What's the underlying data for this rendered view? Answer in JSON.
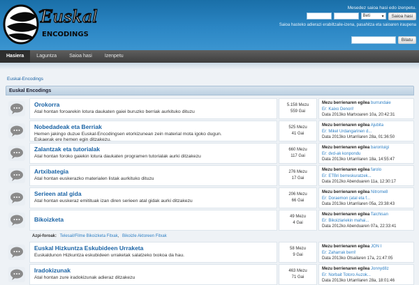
{
  "header": {
    "login_hint": "Mesedez saioa hasi edo izenpetu.",
    "duration_select": "Beti",
    "login_button": "Saioa hasi",
    "login_sub": "Saioa hasteko adierazi erabiltzaile-izena, pasahitza eta saioaren iraupena",
    "search_button": "Bilatu"
  },
  "nav": {
    "items": [
      "Hasiera",
      "Laguntza",
      "Saioa hasi",
      "Izenpetu"
    ]
  },
  "breadcrumb": "Euskal-Encodings",
  "category": "Euskal Encodings",
  "forums": [
    {
      "title": "Orokorra",
      "desc": "Atal hontan foroarekin lotura daukaten gaiei buruzko berriak aurkituko dituzu",
      "desc2": "",
      "messages": "5.158 Mezu",
      "topics": "559 Gai",
      "lp_label": "Mezu berrienaren egilea",
      "lp_user": "burrundaie",
      "lp_reply": "Er: Kaixo Denori!",
      "lp_date": "Data 2013ko Martxoaren 10a, 20:42:31"
    },
    {
      "title": "Nobedadeak eta Berriak",
      "desc": "Hemen jakingo duzue Euskal-Encodingsen etorkizunean zein material mota igoko dugun.",
      "desc2": "Eskaerak ere hemen egin ditzakezu.",
      "messages": "525 Mezu",
      "topics": "41 Gai",
      "lp_label": "Mezu berrienaren egilea",
      "lp_user": "Ajubita",
      "lp_reply": "Er: Mikel Urdangarinen d...",
      "lp_date": "Data 2013ko Urtarrilaren 28a, 01:36:50"
    },
    {
      "title": "Zalantzak eta tutorialak",
      "desc": "Atal hontan foroko gaiekin lotura daukaten programen tutorialak aurki ditzakezu",
      "desc2": "",
      "messages": "660 Mezu",
      "topics": "117 Gai",
      "lp_label": "Mezu berrienaren egilea",
      "lp_user": "baronluigi",
      "lp_reply": "Er: dvd-ak konpondu",
      "lp_date": "Data 2013ko Urtarrilaren 18a, 14:55:47"
    },
    {
      "title": "Artxibategia",
      "desc": "Atal hontan euskerazko materialen listak aurkituko dituzu",
      "desc2": "",
      "messages": "276 Mezu",
      "topics": "17 Gai",
      "lp_label": "Mezu berrienaren egilea",
      "lp_user": "farolo",
      "lp_reply": "Er: ETBri berreskuratzek...",
      "lp_date": "Data 2012ko Abenduaren 11a, 12:30:17"
    },
    {
      "title": "Serieen atal gida",
      "desc": "Atal hontan euskeraz emitituak izan diren serieen atal gidak aurki ditzakezu",
      "desc2": "",
      "messages": "206 Mezu",
      "topics": "66 Gai",
      "lp_label": "Mezu berrienaren egilea",
      "lp_user": "Nitrome8",
      "lp_reply": "Er: Doraemon (atal eta f...",
      "lp_date": "Data 2013ko Urtarrilaren 05a, 23:38:43"
    },
    {
      "title": "Bikoizketa",
      "desc": "",
      "desc2": "",
      "messages": "49 Mezu",
      "topics": "4 Gai",
      "lp_label": "Mezu berrienaren egilea",
      "lp_user": "Taichisan",
      "lp_reply": "Er: Bikoizlariekin mahai...",
      "lp_date": "Data 2012ko Abenduaren 07a, 22:33:41"
    },
    {
      "title": "Euskal Hizkuntza Eskubideen Urraketa",
      "desc": "Euskaldunon Hizkuntza eskubideen urraketak salatzeko txokoa da hau.",
      "desc2": "",
      "messages": "58 Mezu",
      "topics": "9 Gai",
      "lp_label": "Mezu berrienaren egilea",
      "lp_user": "JON I",
      "lp_reply": "Er: Zaharrak berri!",
      "lp_date": "Data 2013ko Otsailaren 17a, 21:47:05"
    },
    {
      "title": "Iradokizunak",
      "desc": "Atal hontan zure iradokizunak adieraz ditzakezu",
      "desc2": "",
      "messages": "463 Mezu",
      "topics": "71 Gai",
      "lp_label": "Mezu berrienaren egilea",
      "lp_user": "Jonnyd8z",
      "lp_reply": "Er: Norbait Totoro Auzok...",
      "lp_date": "Data 2013ko Urtarrilaren 28a, 18:01:46"
    }
  ],
  "subforums": {
    "label": "Azpi-foroak:",
    "links": [
      "Telesail/Filme Bikoizketa Fitxak",
      "Bikoizle Aktoreen Fitxak"
    ]
  },
  "icons": {
    "forum_icon": "speech-bubble-icon",
    "select_icon": "chevron-down-icon"
  },
  "colors": {
    "header_blue": "#2b86c4",
    "link_blue": "#1a63a5",
    "nav_dark": "#3d3d3d"
  }
}
